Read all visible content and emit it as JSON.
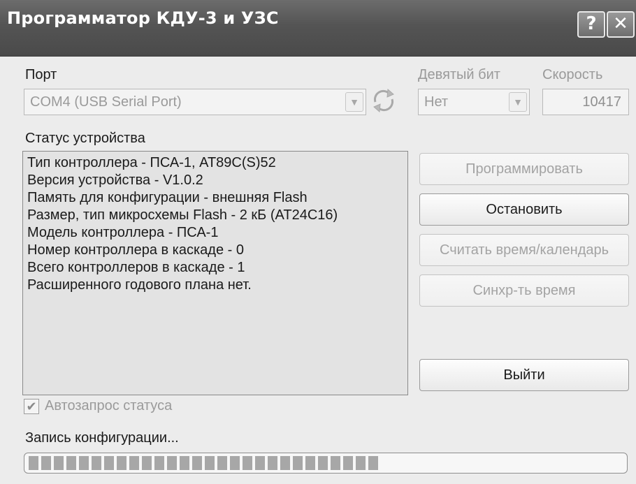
{
  "window": {
    "title": "Программатор КДУ-3 и УЗС",
    "help_label": "?",
    "close_label": "✕"
  },
  "port": {
    "label": "Порт",
    "value": "COM4 (USB Serial Port)"
  },
  "ninth_bit": {
    "label": "Девятый бит",
    "value": "Нет"
  },
  "speed": {
    "label": "Скорость",
    "value": "10417"
  },
  "status": {
    "label": "Статус устройства",
    "lines": [
      "Тип контроллера - ПСА-1, AT89C(S)52",
      "Версия устройства - V1.0.2",
      "Память для конфигурации - внешняя Flash",
      "Размер, тип микросхемы Flash - 2 кБ (AT24C16)",
      "Модель контроллера - ПСА-1",
      "Номер контроллера в каскаде - 0",
      "Всего контроллеров в каскаде - 1",
      "Расширенного годового плана нет."
    ]
  },
  "buttons": {
    "program": "Программировать",
    "stop": "Остановить",
    "read_time": "Считать время/календарь",
    "sync_time": "Синхр-ть время",
    "exit": "Выйти"
  },
  "auto_status": {
    "label": "Автозапрос статуса",
    "checked": true
  },
  "progress": {
    "label": "Запись конфигурации...",
    "fraction": 0.59
  }
}
